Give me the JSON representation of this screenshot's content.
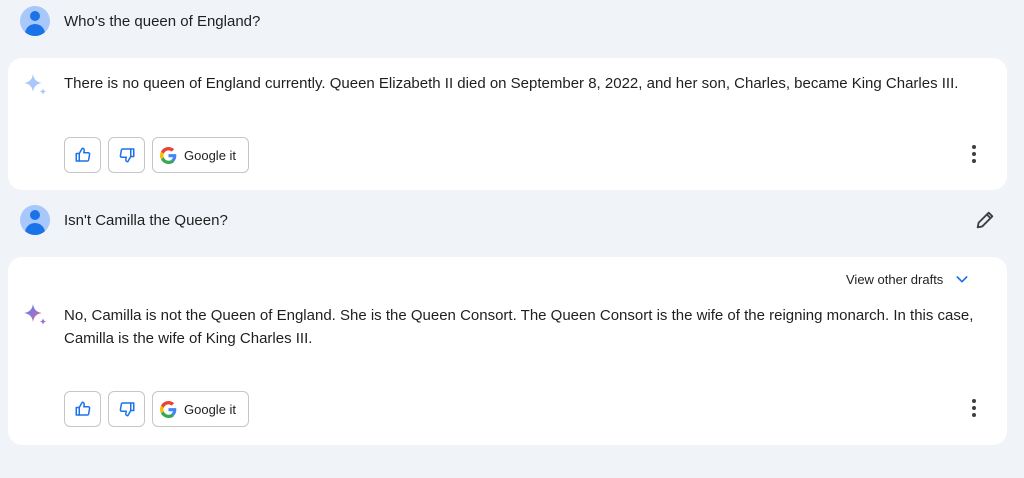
{
  "turns": [
    {
      "prompt": "Who's the queen of England?",
      "response": "There is no queen of England currently. Queen Elizabeth II died on September 8, 2022, and her son, Charles, became King Charles III."
    },
    {
      "prompt": "Isn't Camilla the Queen?",
      "drafts_label": "View other drafts",
      "response_line1": "No, Camilla is not the Queen of England. She is the Queen Consort. The Queen Consort is the wife of the reigning monarch. In this case,",
      "response_line2": "Camilla is the wife of King Charles III."
    }
  ],
  "actions": {
    "google_label": "Google it"
  },
  "icons": {
    "user": "user-avatar-icon",
    "assistant": "sparkle-icon",
    "like": "thumbs-up-icon",
    "dislike": "thumbs-down-icon",
    "google": "google-g-icon",
    "more": "more-vert-icon",
    "edit": "pencil-icon",
    "expand": "chevron-down-icon"
  },
  "colors": {
    "background": "#f0f4f9",
    "card": "#ffffff",
    "accent": "#1a73e8",
    "avatar": "#a8c7fa"
  }
}
